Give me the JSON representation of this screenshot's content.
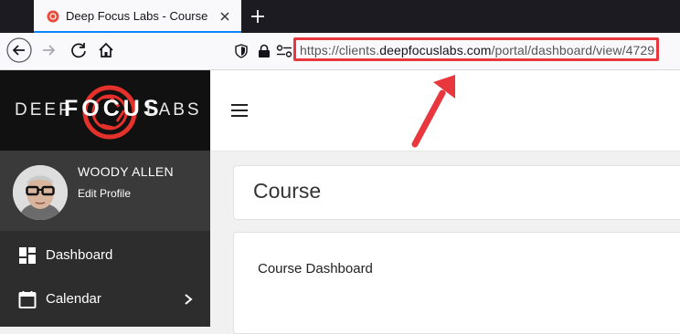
{
  "browser": {
    "tab_title": "Deep Focus Labs - Course",
    "url_prefix": "https://clients.",
    "url_domain": "deepfocuslabs.com",
    "url_path": "/portal/dashboard/view/4729"
  },
  "brand": {
    "word1": "DEEP",
    "word2": "FOCUS",
    "word3": "LABS"
  },
  "profile": {
    "name": "WOODY ALLEN",
    "link": "Edit Profile"
  },
  "menu": [
    {
      "label": "Dashboard",
      "icon": "dashboard-icon"
    },
    {
      "label": "Calendar",
      "icon": "calendar-icon",
      "has_submenu": true
    }
  ],
  "main": {
    "page_title": "Course",
    "panel_text": "Course Dashboard"
  },
  "colors": {
    "annotation": "#e8373d",
    "sidebar": "#2d2d2d",
    "brand_bg": "#111111"
  }
}
